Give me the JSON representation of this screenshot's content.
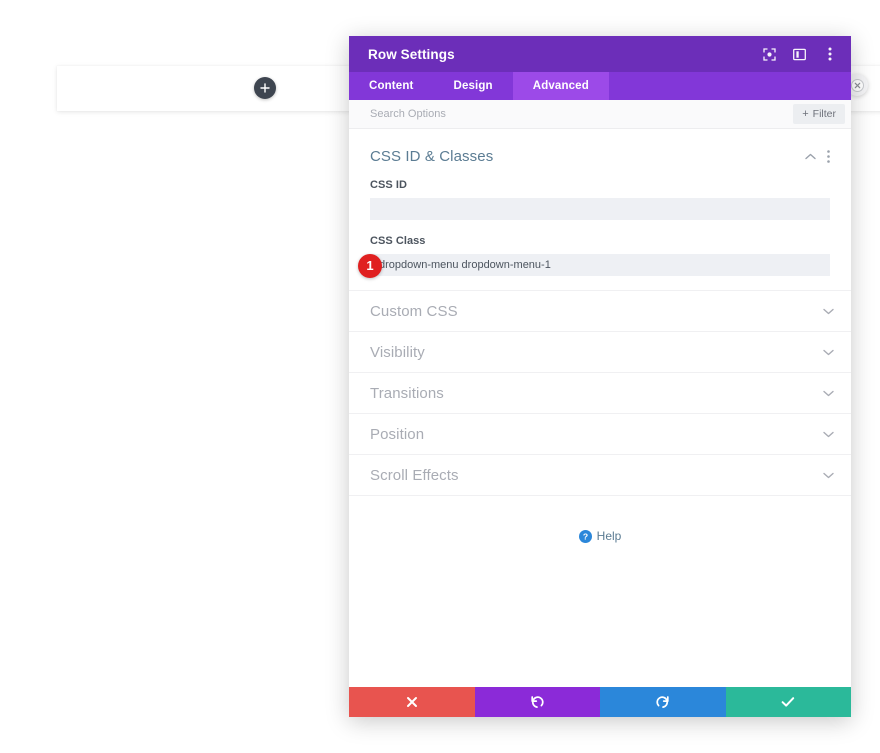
{
  "background": {
    "add_row_icon": "plus-icon",
    "close_icon": "close-circle-icon"
  },
  "modal": {
    "title": "Row Settings",
    "header_icons": [
      {
        "name": "expand-icon",
        "label": "Expand"
      },
      {
        "name": "layout-toggle-icon",
        "label": "Layout"
      },
      {
        "name": "kebab-menu-icon",
        "label": "More options"
      }
    ],
    "tabs": [
      {
        "label": "Content",
        "active": false
      },
      {
        "label": "Design",
        "active": false
      },
      {
        "label": "Advanced",
        "active": true
      }
    ],
    "search": {
      "placeholder": "Search Options",
      "value": ""
    },
    "filter": {
      "label": "Filter",
      "plus": "+"
    },
    "open_section": {
      "title": "CSS ID & Classes",
      "collapse_icon": "chevron-up-icon",
      "menu_icon": "kebab-menu-icon",
      "fields": [
        {
          "label": "CSS ID",
          "value": "",
          "placeholder": "",
          "badge": null
        },
        {
          "label": "CSS Class",
          "value": "dropdown-menu dropdown-menu-1",
          "placeholder": "",
          "badge": "1"
        }
      ]
    },
    "collapsed_sections": [
      {
        "label": "Custom CSS",
        "chevron": "chevron-down-icon"
      },
      {
        "label": "Visibility",
        "chevron": "chevron-down-icon"
      },
      {
        "label": "Transitions",
        "chevron": "chevron-down-icon"
      },
      {
        "label": "Position",
        "chevron": "chevron-down-icon"
      },
      {
        "label": "Scroll Effects",
        "chevron": "chevron-down-icon"
      }
    ],
    "help": {
      "label": "Help",
      "icon": "question-circle-icon"
    },
    "footer_buttons": [
      {
        "name": "cancel-button",
        "icon": "x-icon",
        "color": "#e8544f"
      },
      {
        "name": "undo-button",
        "icon": "undo-icon",
        "color": "#8b2ad8"
      },
      {
        "name": "redo-button",
        "icon": "redo-icon",
        "color": "#2b87da"
      },
      {
        "name": "save-button",
        "icon": "check-icon",
        "color": "#2bb99a"
      }
    ]
  },
  "colors": {
    "header_purple": "#6C2EB9",
    "tabbar_purple": "#8237d8",
    "tab_active_purple": "#9c4ae8",
    "badge_red": "#e02020",
    "heading_blue": "#5b7c93"
  }
}
